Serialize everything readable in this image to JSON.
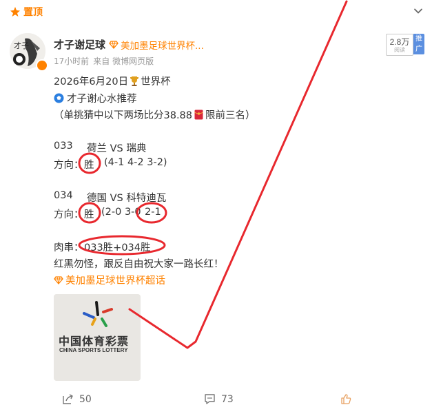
{
  "pinned": {
    "label": "置顶"
  },
  "author": {
    "name": "才子谢足球",
    "super_topic": "美加墨足球世界杯...",
    "time": "17小时前",
    "source": "来自 微博网页版"
  },
  "hot": {
    "count": "2.8万",
    "sub": "阅读",
    "tag": "推广"
  },
  "post": {
    "line1_date": "2026年6月20日",
    "line1_tag": "世界杯",
    "line2": "才子谢心水推荐",
    "line3_a": "（单挑猜中以下两场比分38.88",
    "line3_b": "限前三名）",
    "m1_code": "033",
    "m1_teams": "荷兰 VS 瑞典",
    "m1_dir_label": "方向：",
    "m1_dir": "胜",
    "m1_scores": "(4-1 4-2 3-2)",
    "m2_code": "034",
    "m2_teams": "德国 VS 科特迪瓦",
    "m2_dir_label": "方向：",
    "m2_dir": "胜",
    "m2_scores_a": "(2-0 3-0",
    "m2_scores_b": "2-1",
    "combo_label": "肉串：",
    "combo": "033胜+034胜",
    "closing": "红黑勿怪，跟反自由祝大家一路长红！",
    "topic": "美加墨足球世界杯超话"
  },
  "image": {
    "cn": "中国体育彩票",
    "en": "CHINA SPORTS LOTTERY"
  },
  "actions": {
    "repost": "50",
    "comment": "73"
  },
  "colors": {
    "accent": "#ff8200",
    "annotation": "#e8282e"
  }
}
